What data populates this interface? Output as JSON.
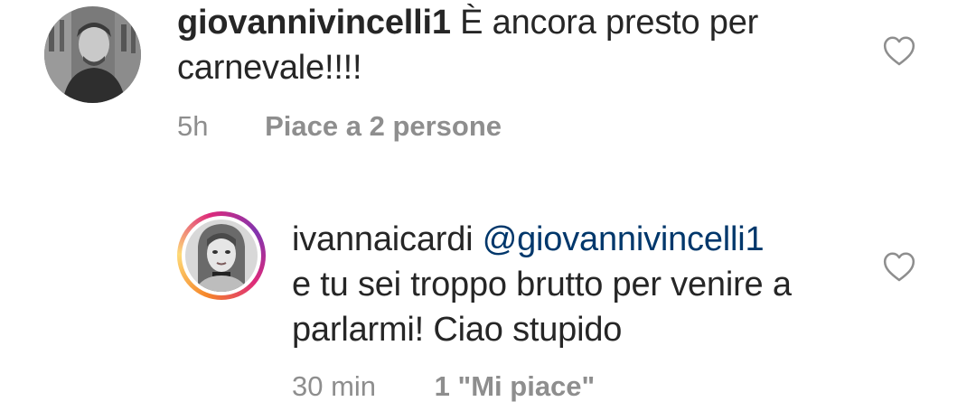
{
  "comments": [
    {
      "username": "giovannivincelli1",
      "text_line1": " È ancora presto per",
      "text_line2": "carnevale!!!!",
      "time": "5h",
      "likes": "Piace a 2 persone",
      "avatar_icon": "profile-photo-icon",
      "like_icon": "heart-outline-icon"
    },
    {
      "username": "ivannaicardi",
      "mention": "@giovannivincelli1",
      "text_line2": "e tu sei troppo brutto per venire a",
      "text_line3": "parlarmi! Ciao stupido",
      "time": "30 min",
      "likes": "1 \"Mi piace\"",
      "avatar_icon": "profile-photo-icon",
      "like_icon": "heart-outline-icon"
    }
  ],
  "colors": {
    "text": "#262626",
    "secondary": "#8e8e8e",
    "mention": "#00376b",
    "background": "#ffffff"
  }
}
